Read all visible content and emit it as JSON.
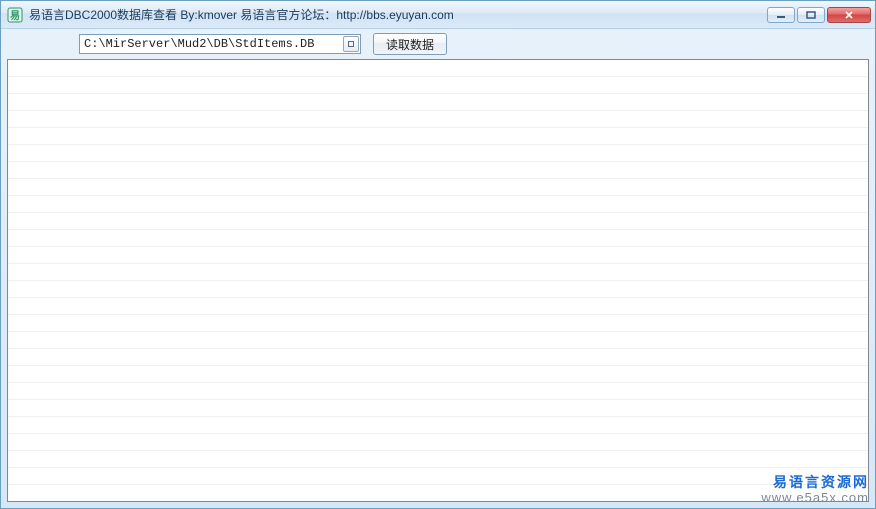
{
  "window": {
    "title": "易语言DBC2000数据库查看 By:kmover   易语言官方论坛：http://bbs.eyuyan.com"
  },
  "toolbar": {
    "path_value": "C:\\MirServer\\Mud2\\DB\\StdItems.DB",
    "read_label": "读取数据"
  },
  "watermark": {
    "line1": "易语言资源网",
    "line2": "www.e5a5x.com"
  }
}
